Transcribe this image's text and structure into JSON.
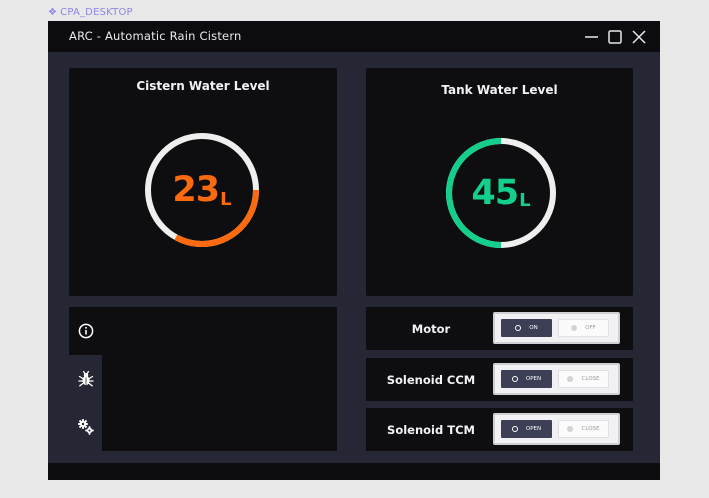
{
  "frame_label": "CPA_DESKTOP",
  "window": {
    "title": "ARC - Automatic Rain Cistern"
  },
  "cistern": {
    "title": "Cistern Water Level",
    "value": "23",
    "unit": "L",
    "fill_fraction": 0.33,
    "color": "#fc6a10"
  },
  "tank": {
    "title": "Tank Water Level",
    "value": "45",
    "unit": "L",
    "fill_fraction": 0.5,
    "color": "#14cf8b"
  },
  "track_color": "#efefef",
  "side_tabs": [
    {
      "icon": "info-icon"
    },
    {
      "icon": "bug-icon"
    },
    {
      "icon": "gears-icon"
    }
  ],
  "controls": [
    {
      "label": "Motor",
      "on_label": "ON",
      "off_label": "OFF",
      "state": "ON"
    },
    {
      "label": "Solenoid CCM",
      "on_label": "OPEN",
      "off_label": "CLOSE",
      "state": "OPEN"
    },
    {
      "label": "Solenoid TCM",
      "on_label": "OPEN",
      "off_label": "CLOSE",
      "state": "OPEN"
    }
  ]
}
